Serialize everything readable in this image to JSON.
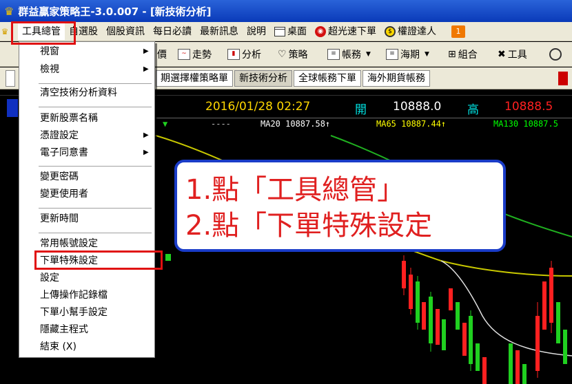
{
  "window": {
    "title": "群益贏家策略王-3.0.007 - [新技術分析]"
  },
  "menubar": {
    "items": [
      "工具總管",
      "自選股",
      "個股資訊",
      "每日必讀",
      "最新訊息",
      "說明",
      "桌面",
      "超光速下單",
      "權證達人"
    ],
    "badge": "1"
  },
  "toolbar": {
    "items": [
      "價",
      "走勢",
      "分析",
      "策略",
      "帳務",
      "海期",
      "組合",
      "工具"
    ]
  },
  "tabs": [
    "期選擇權策略單",
    "新技術分析",
    "全球帳務下單",
    "海外期貨帳務"
  ],
  "chart": {
    "datetime": "2016/01/28 02:27",
    "open_label": "開",
    "open_value": "10888.0",
    "high_label": "高",
    "high_value": "10888.5",
    "left_marker": "▼",
    "dashes": "----",
    "ma20": "MA20  10887.58↑",
    "ma65": "MA65  10887.44↑",
    "ma130": "MA130 10887.5",
    "colors": {
      "date": "#ffd700",
      "open": "#00e0e0",
      "high": "#00e0e0",
      "high_value": "#ff2020",
      "ma20": "#ffffff",
      "ma65": "#ffff00",
      "ma130": "#00ff00"
    }
  },
  "dropdown": {
    "items": [
      "視窗",
      "檢視",
      "清空技術分析資料",
      "更新股票名稱",
      "憑證設定",
      "電子同意書",
      "變更密碼",
      "變更使用者",
      "更新時間",
      "常用帳號設定",
      "下單特殊設定",
      "設定",
      "上傳操作記錄檔",
      "下單小幫手設定",
      "隱藏主程式",
      "結束 (X)"
    ],
    "arrow": "▶"
  },
  "callout": {
    "line1": "1.點「工具總管」",
    "line2": "2.點「下單特殊設定"
  }
}
